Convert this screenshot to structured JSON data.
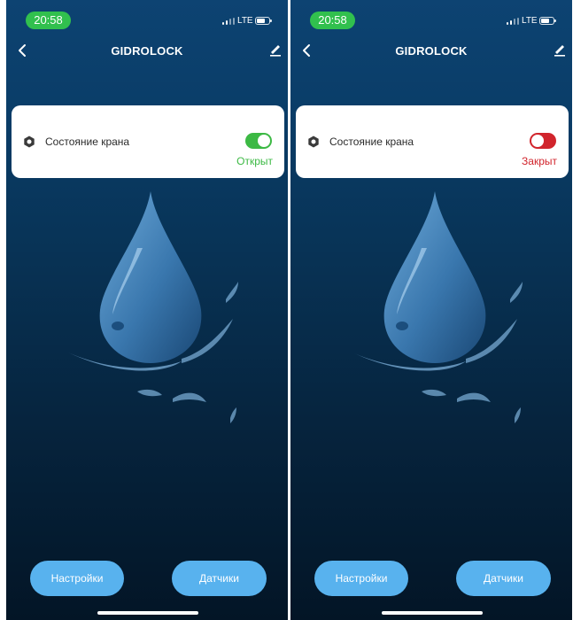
{
  "screens": [
    {
      "status": {
        "time": "20:58",
        "network": "LTE"
      },
      "nav": {
        "title": "GIDROLOCK"
      },
      "card": {
        "label": "Состояние крана",
        "state_text": "Открыт",
        "toggle_on": true,
        "state_color": "#3cb944"
      },
      "buttons": {
        "settings": "Настройки",
        "sensors": "Датчики"
      }
    },
    {
      "status": {
        "time": "20:58",
        "network": "LTE"
      },
      "nav": {
        "title": "GIDROLOCK"
      },
      "card": {
        "label": "Состояние крана",
        "state_text": "Закрыт",
        "toggle_on": false,
        "state_color": "#d1242c"
      },
      "buttons": {
        "settings": "Настройки",
        "sensors": "Датчики"
      }
    }
  ],
  "colors": {
    "time_pill": "#31c04e",
    "button": "#58b2ee",
    "toggle_on": "#3cb944",
    "toggle_off": "#d1242c"
  },
  "icons": [
    "back-chevron-icon",
    "edit-pencil-icon",
    "valve-nut-icon",
    "water-drop-illustration"
  ]
}
